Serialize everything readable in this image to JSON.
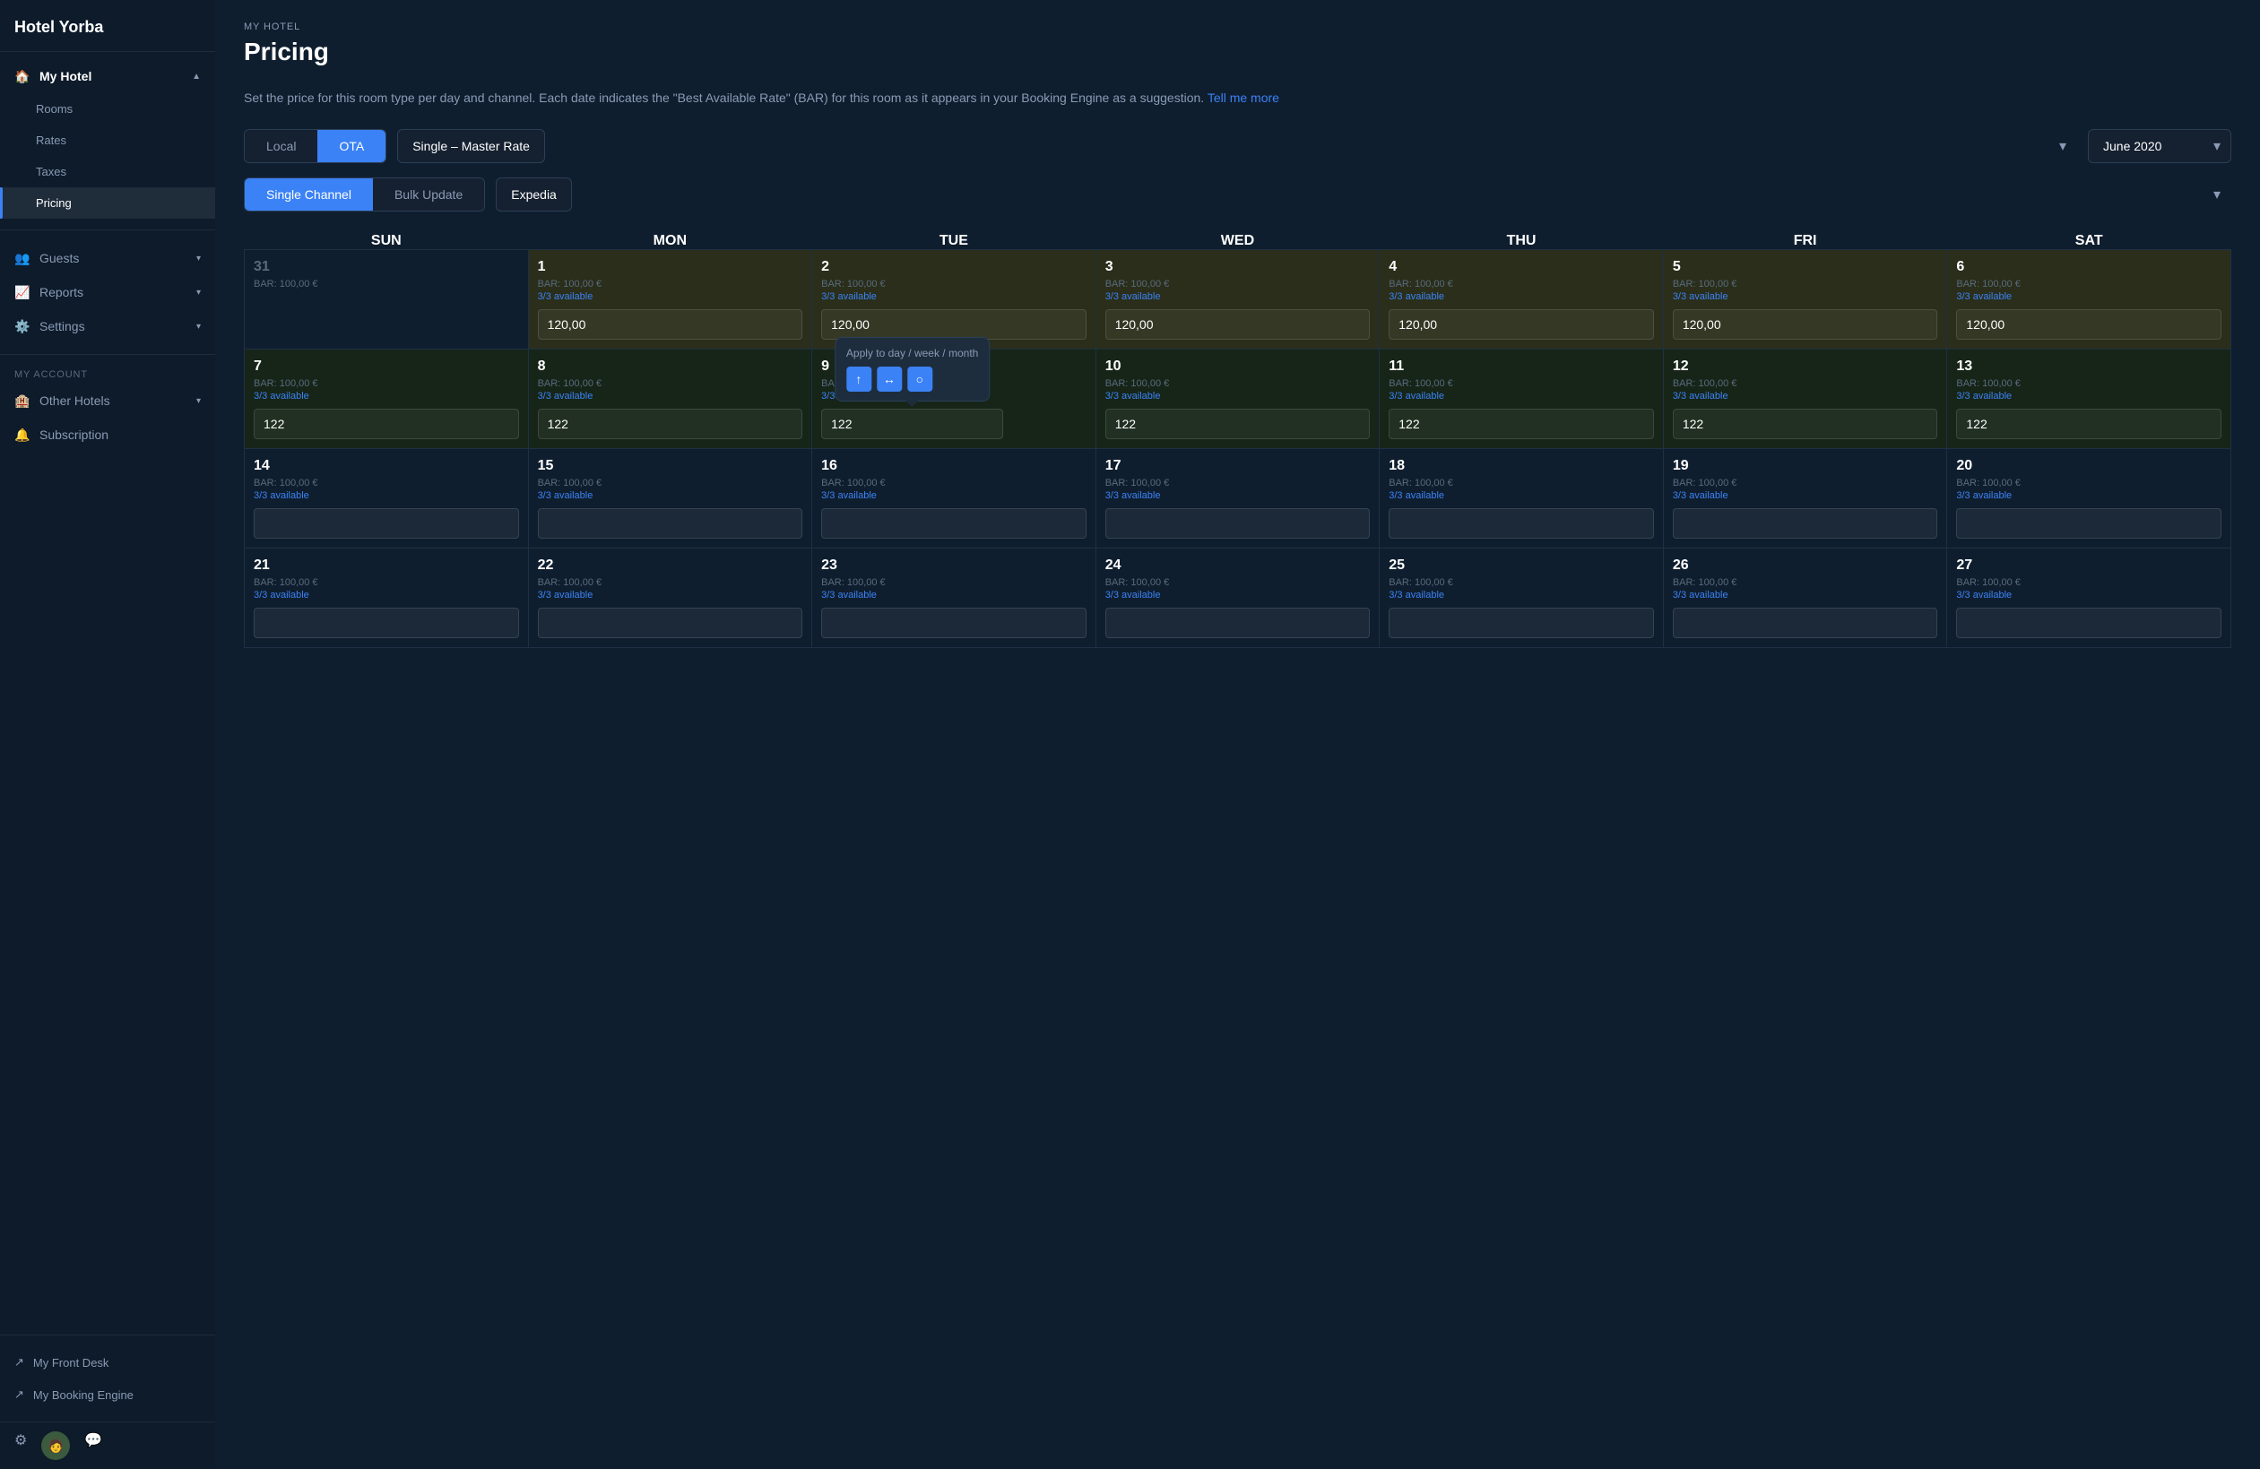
{
  "sidebar": {
    "hotel_name": "Hotel Yorba",
    "nav": {
      "my_hotel": "My Hotel",
      "rooms": "Rooms",
      "rates": "Rates",
      "taxes": "Taxes",
      "pricing": "Pricing",
      "guests": "Guests",
      "reports": "Reports",
      "settings": "Settings"
    },
    "account_section": "MY ACCOUNT",
    "other_hotels": "Other Hotels",
    "subscription": "Subscription",
    "my_front_desk": "My Front Desk",
    "my_booking_engine": "My Booking Engine"
  },
  "breadcrumb": "MY HOTEL",
  "page_title": "Pricing",
  "description": "Set the price for this room type per day and channel. Each date indicates the \"Best Available Rate\" (BAR) for this room as it appears in your Booking Engine as a suggestion.",
  "tell_me_more": "Tell me more",
  "tab_local": "Local",
  "tab_ota": "OTA",
  "rate_value": "Single – Master Rate",
  "month_value": "June 2020",
  "tab_single_channel": "Single Channel",
  "tab_bulk_update": "Bulk Update",
  "channel_value": "Expedia",
  "days": [
    "SUN",
    "MON",
    "TUE",
    "WED",
    "THU",
    "FRI",
    "SAT"
  ],
  "tooltip": {
    "title": "Apply to day / week / month",
    "btn_day": "↑",
    "btn_week": "↔",
    "btn_month": "○"
  },
  "weeks": [
    {
      "days": [
        {
          "num": "31",
          "bar": "BAR: 100,00 €",
          "avail": "",
          "value": "",
          "type": "empty",
          "dimmed": true
        },
        {
          "num": "1",
          "bar": "BAR: 100,00 €",
          "avail": "3/3 available",
          "value": "120,00",
          "type": "yellow"
        },
        {
          "num": "2",
          "bar": "BAR: 100,00 €",
          "avail": "3/3 available",
          "value": "120,00",
          "type": "yellow"
        },
        {
          "num": "3",
          "bar": "BAR: 100,00 €",
          "avail": "3/3 available",
          "value": "120,00",
          "type": "yellow"
        },
        {
          "num": "4",
          "bar": "BAR: 100,00 €",
          "avail": "3/3 available",
          "value": "120,00",
          "type": "yellow"
        },
        {
          "num": "5",
          "bar": "BAR: 100,00 €",
          "avail": "3/3 available",
          "value": "120,00",
          "type": "yellow"
        },
        {
          "num": "6",
          "bar": "BAR: 100,00 €",
          "avail": "3/3 available",
          "value": "120,00",
          "type": "yellow"
        }
      ]
    },
    {
      "days": [
        {
          "num": "7",
          "bar": "BAR: 100,00 €",
          "avail": "3/3 available",
          "value": "122",
          "type": "green"
        },
        {
          "num": "8",
          "bar": "BAR: 100,00 €",
          "avail": "3/3 available",
          "value": "122",
          "type": "green"
        },
        {
          "num": "9",
          "bar": "BAR: 100,00 €",
          "avail": "3/3 available",
          "value": "122",
          "type": "green",
          "tooltip": true
        },
        {
          "num": "10",
          "bar": "BAR: 100,00 €",
          "avail": "3/3 available",
          "value": "122",
          "type": "green"
        },
        {
          "num": "11",
          "bar": "BAR: 100,00 €",
          "avail": "3/3 available",
          "value": "122",
          "type": "green"
        },
        {
          "num": "12",
          "bar": "BAR: 100,00 €",
          "avail": "3/3 available",
          "value": "122",
          "type": "green"
        },
        {
          "num": "13",
          "bar": "BAR: 100,00 €",
          "avail": "3/3 available",
          "value": "122",
          "type": "green"
        }
      ]
    },
    {
      "days": [
        {
          "num": "14",
          "bar": "BAR: 100,00 €",
          "avail": "3/3 available",
          "value": "",
          "type": "default"
        },
        {
          "num": "15",
          "bar": "BAR: 100,00 €",
          "avail": "3/3 available",
          "value": "",
          "type": "default"
        },
        {
          "num": "16",
          "bar": "BAR: 100,00 €",
          "avail": "3/3 available",
          "value": "",
          "type": "default"
        },
        {
          "num": "17",
          "bar": "BAR: 100,00 €",
          "avail": "3/3 available",
          "value": "",
          "type": "default"
        },
        {
          "num": "18",
          "bar": "BAR: 100,00 €",
          "avail": "3/3 available",
          "value": "",
          "type": "default"
        },
        {
          "num": "19",
          "bar": "BAR: 100,00 €",
          "avail": "3/3 available",
          "value": "",
          "type": "default"
        },
        {
          "num": "20",
          "bar": "BAR: 100,00 €",
          "avail": "3/3 available",
          "value": "",
          "type": "default"
        }
      ]
    },
    {
      "days": [
        {
          "num": "21",
          "bar": "BAR: 100,00 €",
          "avail": "3/3 available",
          "value": "",
          "type": "default"
        },
        {
          "num": "22",
          "bar": "BAR: 100,00 €",
          "avail": "3/3 available",
          "value": "",
          "type": "default"
        },
        {
          "num": "23",
          "bar": "BAR: 100,00 €",
          "avail": "3/3 available",
          "value": "",
          "type": "default"
        },
        {
          "num": "24",
          "bar": "BAR: 100,00 €",
          "avail": "3/3 available",
          "value": "",
          "type": "default"
        },
        {
          "num": "25",
          "bar": "BAR: 100,00 €",
          "avail": "3/3 available",
          "value": "",
          "type": "default"
        },
        {
          "num": "26",
          "bar": "BAR: 100,00 €",
          "avail": "3/3 available",
          "value": "",
          "type": "default"
        },
        {
          "num": "27",
          "bar": "BAR: 100,00 €",
          "avail": "3/3 available",
          "value": "",
          "type": "default"
        }
      ]
    }
  ]
}
